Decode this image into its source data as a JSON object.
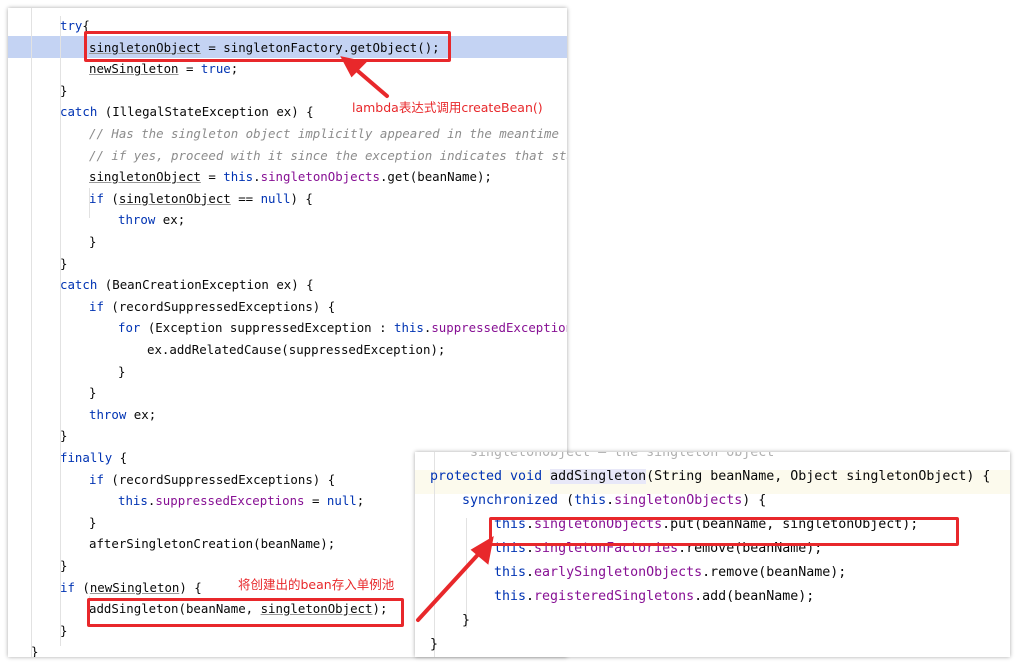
{
  "left_code": [
    {
      "indent": 0,
      "tokens": [
        [
          "kw",
          "try"
        ],
        [
          "",
          "{"
        ]
      ]
    },
    {
      "indent": 1,
      "highlight": true,
      "tokens": [
        [
          "ul",
          "singletonObject"
        ],
        [
          "",
          " = singletonFactory.getObject();"
        ]
      ]
    },
    {
      "indent": 1,
      "tokens": [
        [
          "ul",
          "newSingleton"
        ],
        [
          "",
          " = "
        ],
        [
          "kw",
          "true"
        ],
        [
          "",
          ";"
        ]
      ]
    },
    {
      "indent": 0,
      "tokens": [
        [
          "",
          "}"
        ]
      ]
    },
    {
      "indent": 0,
      "tokens": [
        [
          "kw",
          "catch"
        ],
        [
          "",
          " (IllegalStateException ex) {"
        ]
      ]
    },
    {
      "indent": 1,
      "tokens": [
        [
          "cmt",
          "// Has the singleton object implicitly appeared in the meantime -> if"
        ]
      ]
    },
    {
      "indent": 1,
      "tokens": [
        [
          "cmt",
          "// if yes, proceed with it since the exception indicates that state."
        ]
      ]
    },
    {
      "indent": 1,
      "tokens": [
        [
          "ul",
          "singletonObject"
        ],
        [
          "",
          " = "
        ],
        [
          "kw",
          "this"
        ],
        [
          "",
          "."
        ],
        [
          "fld",
          "singletonObjects"
        ],
        [
          "",
          ".get(beanName);"
        ]
      ]
    },
    {
      "indent": 1,
      "tokens": [
        [
          "kw",
          "if"
        ],
        [
          "",
          " ("
        ],
        [
          "ul",
          "singletonObject"
        ],
        [
          "",
          " == "
        ],
        [
          "kw",
          "null"
        ],
        [
          "",
          ") {"
        ]
      ]
    },
    {
      "indent": 2,
      "tokens": [
        [
          "kw",
          "throw"
        ],
        [
          "",
          " ex;"
        ]
      ]
    },
    {
      "indent": 1,
      "tokens": [
        [
          "",
          "}"
        ]
      ]
    },
    {
      "indent": 0,
      "tokens": [
        [
          "",
          "}"
        ]
      ]
    },
    {
      "indent": 0,
      "tokens": [
        [
          "kw",
          "catch"
        ],
        [
          "",
          " (BeanCreationException ex) {"
        ]
      ]
    },
    {
      "indent": 1,
      "tokens": [
        [
          "kw",
          "if"
        ],
        [
          "",
          " (recordSuppressedExceptions) {"
        ]
      ]
    },
    {
      "indent": 2,
      "tokens": [
        [
          "kw",
          "for"
        ],
        [
          "",
          " (Exception suppressedException : "
        ],
        [
          "kw",
          "this"
        ],
        [
          "",
          "."
        ],
        [
          "fld",
          "suppressedExceptions"
        ],
        [
          "",
          ") {"
        ]
      ]
    },
    {
      "indent": 3,
      "tokens": [
        [
          "",
          "ex.addRelatedCause(suppressedException);"
        ]
      ]
    },
    {
      "indent": 2,
      "tokens": [
        [
          "",
          "}"
        ]
      ]
    },
    {
      "indent": 1,
      "tokens": [
        [
          "",
          "}"
        ]
      ]
    },
    {
      "indent": 1,
      "tokens": [
        [
          "kw",
          "throw"
        ],
        [
          "",
          " ex;"
        ]
      ]
    },
    {
      "indent": 0,
      "tokens": [
        [
          "",
          "}"
        ]
      ]
    },
    {
      "indent": 0,
      "tokens": [
        [
          "kw",
          "finally"
        ],
        [
          "",
          " {"
        ]
      ]
    },
    {
      "indent": 1,
      "tokens": [
        [
          "kw",
          "if"
        ],
        [
          "",
          " (recordSuppressedExceptions) {"
        ]
      ]
    },
    {
      "indent": 2,
      "tokens": [
        [
          "kw",
          "this"
        ],
        [
          "",
          "."
        ],
        [
          "fld",
          "suppressedExceptions"
        ],
        [
          "",
          " = "
        ],
        [
          "kw",
          "null"
        ],
        [
          "",
          ";"
        ]
      ]
    },
    {
      "indent": 1,
      "tokens": [
        [
          "",
          "}"
        ]
      ]
    },
    {
      "indent": 1,
      "tokens": [
        [
          "",
          "afterSingletonCreation(beanName);"
        ]
      ]
    },
    {
      "indent": 0,
      "tokens": [
        [
          "",
          "}"
        ]
      ]
    },
    {
      "indent": 0,
      "tokens": [
        [
          "kw",
          "if"
        ],
        [
          "",
          " ("
        ],
        [
          "ul",
          "newSingleton"
        ],
        [
          "",
          ") {"
        ]
      ]
    },
    {
      "indent": 1,
      "tokens": [
        [
          "",
          "addSingleton(beanName, "
        ],
        [
          "ul",
          "singletonObject"
        ],
        [
          "",
          ");"
        ]
      ]
    },
    {
      "indent": 0,
      "tokens": [
        [
          "",
          "}"
        ]
      ]
    },
    {
      "indent": -1,
      "tokens": [
        [
          "",
          "}"
        ]
      ]
    }
  ],
  "right_code": [
    {
      "indent": 0,
      "tokens": [
        [
          "faded",
          "     singletonObject – the singleton object"
        ]
      ],
      "faded": true
    },
    {
      "indent": 0,
      "highlight": true,
      "tokens": [
        [
          "kw",
          "protected void "
        ],
        [
          "fn",
          "addSingleton"
        ],
        [
          "",
          "(String beanName, Object singletonObject) {"
        ]
      ]
    },
    {
      "indent": 1,
      "tokens": [
        [
          "kw",
          "synchronized"
        ],
        [
          "",
          " ("
        ],
        [
          "kw",
          "this"
        ],
        [
          "",
          "."
        ],
        [
          "fld",
          "singletonObjects"
        ],
        [
          "",
          ") {"
        ]
      ]
    },
    {
      "indent": 2,
      "tokens": [
        [
          "kw",
          "this"
        ],
        [
          "",
          "."
        ],
        [
          "fld",
          "singletonObjects"
        ],
        [
          "",
          ".put(beanName, singletonObject);"
        ]
      ]
    },
    {
      "indent": 2,
      "tokens": [
        [
          "kw",
          "this"
        ],
        [
          "",
          "."
        ],
        [
          "fld",
          "singletonFactories"
        ],
        [
          "",
          ".remove(beanName);"
        ]
      ]
    },
    {
      "indent": 2,
      "tokens": [
        [
          "kw",
          "this"
        ],
        [
          "",
          "."
        ],
        [
          "fld",
          "earlySingletonObjects"
        ],
        [
          "",
          ".remove(beanName);"
        ]
      ]
    },
    {
      "indent": 2,
      "tokens": [
        [
          "kw",
          "this"
        ],
        [
          "",
          "."
        ],
        [
          "fld",
          "registeredSingletons"
        ],
        [
          "",
          ".add(beanName);"
        ]
      ]
    },
    {
      "indent": 1,
      "tokens": [
        [
          "",
          "}"
        ]
      ]
    },
    {
      "indent": 0,
      "tokens": [
        [
          "",
          "}"
        ]
      ]
    }
  ],
  "annotations": {
    "lambda_note": "lambda表达式调用createBean()",
    "pool_note": "将创建出的bean存入单例池"
  },
  "colors": {
    "annotation": "#e8282b",
    "keyword": "#0033b3",
    "field": "#871094",
    "comment": "#8c8c8c",
    "line_highlight": "#c4d3f3"
  }
}
